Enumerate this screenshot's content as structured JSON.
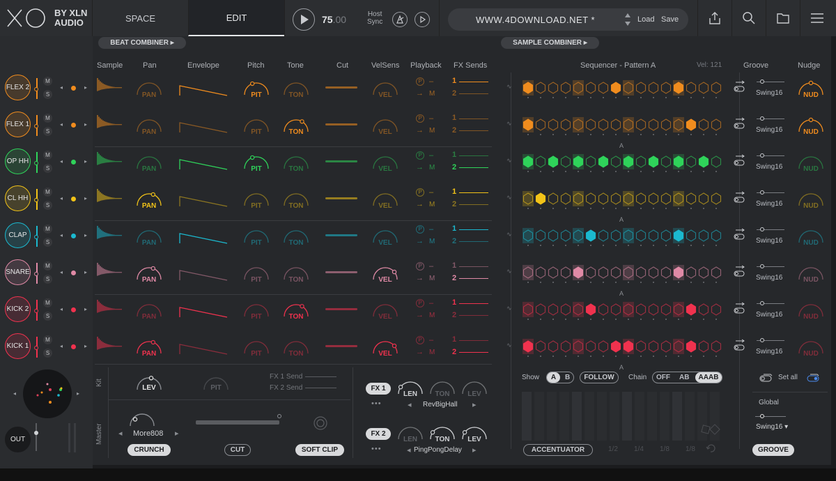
{
  "header": {
    "brand_top": "BY XLN",
    "brand_bottom": "AUDIO",
    "tabs": [
      "SPACE",
      "EDIT"
    ],
    "tempo_int": "75",
    "tempo_dec": ".00",
    "host_sync_1": "Host",
    "host_sync_2": "Sync",
    "preset_name": "WWW.4DOWNLOAD.NET *",
    "load_label": "Load",
    "save_label": "Save"
  },
  "left_panel": {
    "beat_combiner": "BEAT COMBINER",
    "col_headers": [
      "Sample",
      "Pan",
      "Envelope",
      "Pitch",
      "Tone",
      "Cut",
      "VelSens",
      "Playback",
      "FX Sends"
    ],
    "tracks": [
      {
        "name": "FLEX 2",
        "color": "#f08c1e",
        "active_knob": "PIT",
        "send_active": "1"
      },
      {
        "name": "FLEX 1",
        "color": "#f08c1e",
        "active_knob": "TON",
        "send_active": "none"
      },
      {
        "name": "OP HH",
        "color": "#2fd35a",
        "active_knob": "PIT",
        "send_active": "2"
      },
      {
        "name": "CL HH",
        "color": "#f2c318",
        "active_knob": "PAN",
        "send_active": "1"
      },
      {
        "name": "CLAP",
        "color": "#1bb9cf",
        "active_knob": "none",
        "send_active": "1"
      },
      {
        "name": "SNARE",
        "color": "#e08aa6",
        "active_knob": "PAN",
        "send_active": "2"
      },
      {
        "name": "KICK 2",
        "color": "#f0324e",
        "active_knob": "TON",
        "send_active": "1"
      },
      {
        "name": "KICK 1",
        "color": "#f0324e",
        "active_knob": "PAN",
        "send_active": "2"
      }
    ],
    "knob_labels": {
      "pan": "PAN",
      "pit": "PIT",
      "ton": "TON",
      "vel": "VEL"
    },
    "m_label": "M",
    "s_label": "S",
    "out_label": "OUT",
    "kit_label": "Kit",
    "kit_lev": "LEV",
    "kit_pit": "PIT",
    "fx1_send": "FX 1 Send",
    "fx2_send": "FX 2 Send",
    "master_label": "Master",
    "crunch_preset": "More808",
    "crunch_btn": "CRUNCH",
    "cut_btn": "CUT",
    "softclip_btn": "SOFT CLIP",
    "fx1": {
      "label": "FX 1",
      "len": "LEN",
      "ton": "TON",
      "lev": "LEV",
      "preset": "RevBigHall"
    },
    "fx2": {
      "label": "FX 2",
      "len": "LEN",
      "ton": "TON",
      "lev": "LEV",
      "preset": "PingPongDelay"
    },
    "playback_m": "M",
    "playback_dash": "–",
    "send_1": "1",
    "send_2": "2"
  },
  "right_panel": {
    "sample_combiner": "SAMPLE COMBINER",
    "sequencer_title": "Sequencer - Pattern A",
    "vel_readout": "Vel: 121",
    "groove_header": "Groove",
    "nudge_header": "Nudge",
    "groove_value": "Swing16",
    "nudge_label": "NUD",
    "pattern_marker": "A",
    "show_label": "Show",
    "show_a": "A",
    "show_b": "B",
    "follow_btn": "FOLLOW",
    "chain_label": "Chain",
    "chain_off": "OFF",
    "chain_ab": "AB",
    "chain_aaab": "AAAB",
    "accentuator_btn": "ACCENTUATOR",
    "set_all": "Set all",
    "global_label": "Global",
    "global_value": "Swing16 ▾",
    "groove_btn": "GROOVE",
    "fractions": [
      "1/2",
      "1/4",
      "1/8",
      "1/8"
    ],
    "steps": [
      [
        1,
        0,
        0,
        0,
        0,
        0,
        0,
        1,
        0,
        0,
        0,
        0,
        1,
        0,
        0,
        0
      ],
      [
        1,
        0,
        0,
        0,
        0,
        0,
        0,
        0,
        0,
        0,
        0,
        0,
        0,
        1,
        0,
        0
      ],
      [
        1,
        0,
        1,
        0,
        1,
        0,
        1,
        0,
        1,
        0,
        1,
        0,
        1,
        0,
        1,
        0
      ],
      [
        0,
        1,
        0,
        0,
        0,
        0,
        0,
        0,
        0,
        0,
        0,
        0,
        0,
        0,
        0,
        0
      ],
      [
        0,
        0,
        0,
        0,
        0,
        1,
        0,
        0,
        0,
        0,
        0,
        0,
        1,
        0,
        0,
        0
      ],
      [
        0,
        0,
        0,
        0,
        1,
        0,
        0,
        0,
        0,
        0,
        0,
        0,
        1,
        0,
        0,
        0
      ],
      [
        0,
        0,
        0,
        0,
        0,
        1,
        0,
        0,
        0,
        0,
        0,
        0,
        0,
        1,
        0,
        0
      ],
      [
        1,
        0,
        0,
        0,
        0,
        0,
        0,
        1,
        1,
        0,
        0,
        0,
        0,
        1,
        0,
        0
      ]
    ]
  }
}
